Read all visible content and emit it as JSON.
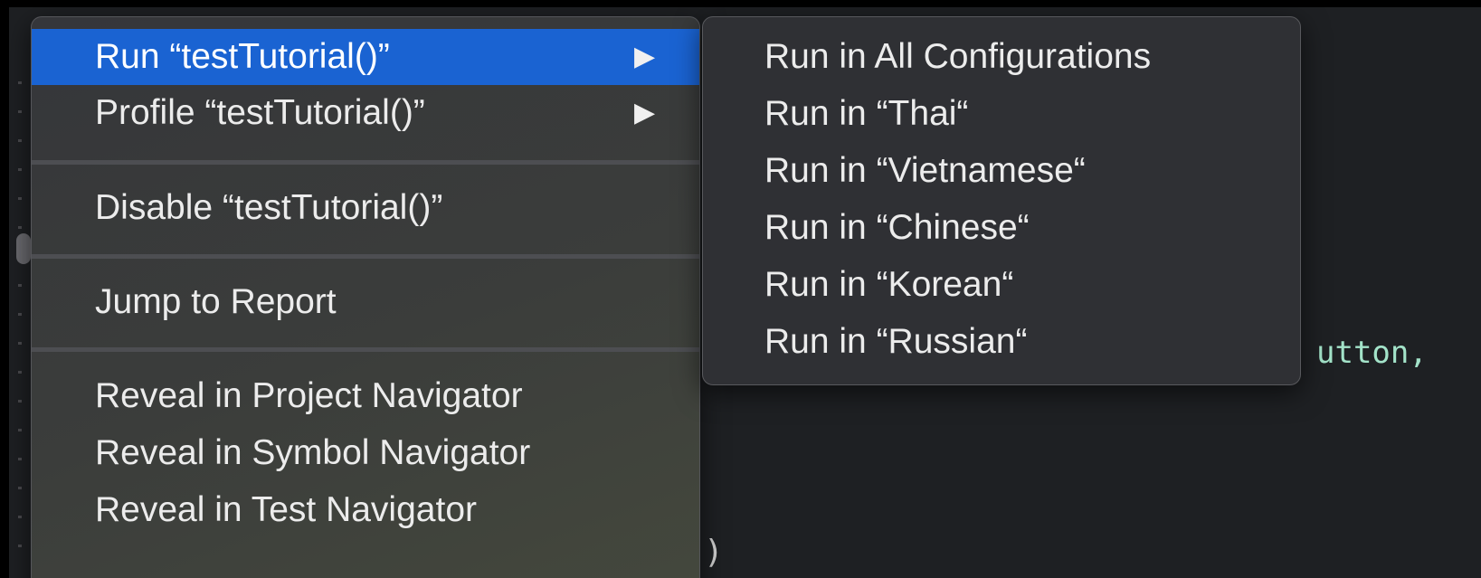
{
  "editor": {
    "code_fragment": "utton,",
    "closing_brace": ")"
  },
  "context_menu": {
    "items": [
      {
        "label": "Run “testTutorial()”",
        "has_submenu": true,
        "highlighted": true
      },
      {
        "label": "Profile “testTutorial()”",
        "has_submenu": true,
        "highlighted": false
      },
      {
        "label": "Disable “testTutorial()”",
        "has_submenu": false,
        "highlighted": false
      },
      {
        "label": "Jump to Report",
        "has_submenu": false,
        "highlighted": false
      },
      {
        "label": "Reveal in Project Navigator",
        "has_submenu": false,
        "highlighted": false
      },
      {
        "label": "Reveal in Symbol Navigator",
        "has_submenu": false,
        "highlighted": false
      },
      {
        "label": "Reveal in Test Navigator",
        "has_submenu": false,
        "highlighted": false
      }
    ],
    "submenu_arrow_icon": "triangle-right-icon"
  },
  "run_submenu": {
    "items": [
      {
        "label": "Run in All Configurations"
      },
      {
        "label": "Run in “Thai“"
      },
      {
        "label": "Run in “Vietnamese“"
      },
      {
        "label": "Run in “Chinese“"
      },
      {
        "label": "Run in “Korean“"
      },
      {
        "label": "Run in “Russian“"
      }
    ]
  },
  "colors": {
    "highlight": "#1a63d2",
    "menu_text": "#ececec",
    "code_text": "#a3e3c9"
  }
}
